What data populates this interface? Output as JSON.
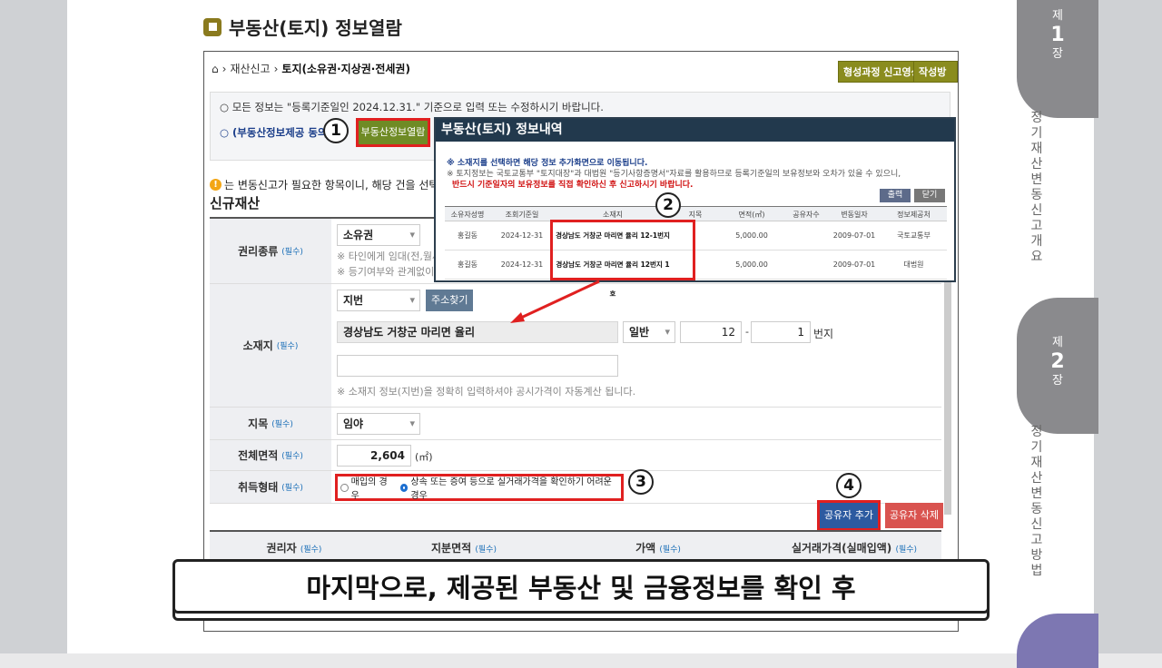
{
  "page_title": "부동산(토지) 정보열람",
  "breadcrumb": {
    "item1": "재산신고",
    "item2": "토지(소유권·지상권·전세권)"
  },
  "top_buttons": {
    "video": "형성과정 신고영상",
    "guide": "작성방법"
  },
  "info": {
    "line1": "○ 모든 정보는 \"등록기준일인 2024.12.31.\" 기준으로 입력 또는 수정하시기 바랍니다.",
    "line2": "○ (부동산정보제공 동의자",
    "view_button": "부동산정보열람"
  },
  "warning": "는 변동신고가 필요한 항목이니, 해당 건을 선택하여 변동",
  "section_title": "신규재산",
  "required": "(필수)",
  "form": {
    "right_type": {
      "label": "권리종류",
      "value": "소유권",
      "note1": "※ 타인에게 임대(전,월세",
      "note2": "※ 등기여부와 관계없이 신"
    },
    "location": {
      "label": "소재지",
      "type": "지번",
      "search": "주소찾기",
      "address": "경상남도 거창군 마리면 율리",
      "kind": "일반",
      "num1": "12",
      "dash": "-",
      "num2": "1",
      "unit": "번지",
      "detail": "",
      "note": "※ 소재지 정보(지번)을 정확히 입력하셔야 공시가격이 자동계산 됩니다."
    },
    "land_category": {
      "label": "지목",
      "value": "임야"
    },
    "area": {
      "label": "전체면적",
      "value": "2,604",
      "unit": "(㎡)"
    },
    "acquisition": {
      "label": "취득형태",
      "opt1": "매입의 경우",
      "opt2": "상속 또는 증여 등으로 실거래가격을 확인하기 어려운 경우",
      "selected": "opt2"
    }
  },
  "owner_buttons": {
    "add": "공유자 추가",
    "delete": "공유자 삭제"
  },
  "table_head": [
    "권리자",
    "지분면적",
    "가액",
    "실거래가격(실매입액)"
  ],
  "popup": {
    "title": "부동산(토지) 정보내역",
    "note1": "※ 소재지를 선택하면 해당 정보 추가화면으로 이동됩니다.",
    "note2": "※ 토지정보는 국토교통부 \"토지대장\"과 대법원 \"등기사항증명서\"자료를 활용하므로 등록기준일의 보유정보와 오차가 있을 수 있으니,",
    "note3": "반드시 기준일자의 보유정보를 직접 확인하신 후 신고하시기 바랍니다.",
    "print": "출력",
    "close": "닫기",
    "columns": [
      "소유자성명",
      "조회기준일",
      "소재지",
      "지목",
      "면적(㎡)",
      "공유자수",
      "변동일자",
      "정보제공처"
    ],
    "rows": [
      [
        "홍길동",
        "2024-12-31",
        "경상남도 거창군 마리면 율리 12-1번지",
        "",
        "5,000.00",
        "",
        "2009-07-01",
        "국토교통부"
      ],
      [
        "홍길동",
        "2024-12-31",
        "경상남도 거창군 마리면 율리 12번지 1호",
        "",
        "5,000.00",
        "",
        "2009-07-01",
        "대법원"
      ]
    ]
  },
  "markers": [
    "1",
    "2",
    "3",
    "4"
  ],
  "subtitle": "마지막으로, 제공된 부동산 및 금융정보를 확인 후",
  "side_tabs": {
    "tab1": {
      "top": "제",
      "num": "1",
      "bottom": "장"
    },
    "tab2": {
      "top": "제",
      "num": "2",
      "bottom": "장"
    }
  },
  "side_text1": "정기재산변동신고개요",
  "side_text2": "정기재산변동신고방법",
  "colors": {
    "accent_red": "#e02020",
    "popup_header": "#22394d",
    "olive": "#8a8c1e",
    "add_blue": "#2c5aa0",
    "delete_red": "#d9534f"
  }
}
